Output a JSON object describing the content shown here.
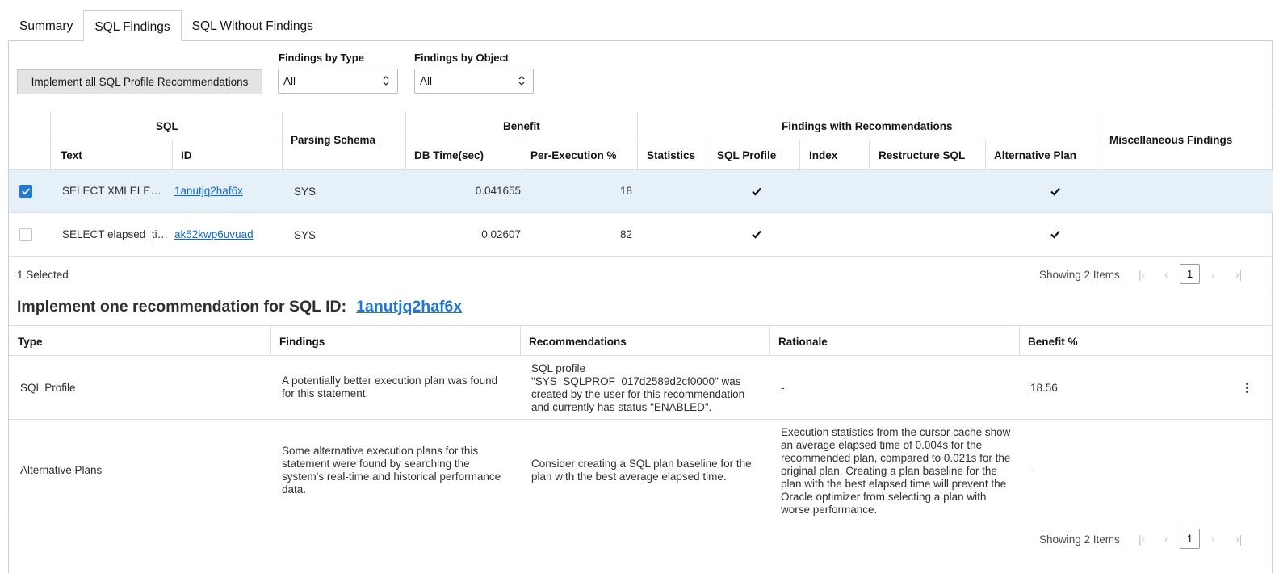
{
  "tabs": [
    {
      "label": "Summary"
    },
    {
      "label": "SQL Findings",
      "active": true
    },
    {
      "label": "SQL Without Findings"
    }
  ],
  "toolbar": {
    "implement_all_label": "Implement all SQL Profile Recommendations",
    "findings_by_type": {
      "label": "Findings by Type",
      "value": "All"
    },
    "findings_by_object": {
      "label": "Findings by Object",
      "value": "All"
    }
  },
  "sql_table": {
    "group_headers": {
      "sql": "SQL",
      "parsing_schema": "Parsing Schema",
      "benefit": "Benefit",
      "findings_with_recommendations": "Findings with Recommendations",
      "misc_findings": "Miscellaneous Findings"
    },
    "sub_headers": {
      "text": "Text",
      "id": "ID",
      "db_time": "DB Time(sec)",
      "per_execution": "Per-Execution %",
      "statistics": "Statistics",
      "sql_profile": "SQL Profile",
      "index": "Index",
      "restructure_sql": "Restructure SQL",
      "alternative_plan": "Alternative Plan"
    },
    "rows": [
      {
        "selected": true,
        "text": "SELECT XMLELE…",
        "id": "1anutjq2haf6x",
        "schema": "SYS",
        "db_time": "0.041655",
        "per_execution": "18",
        "sql_profile": true,
        "alternative_plan": true
      },
      {
        "selected": false,
        "text": "SELECT elapsed_ti…",
        "id": "ak52kwp6uvuad",
        "schema": "SYS",
        "db_time": "0.02607",
        "per_execution": "82",
        "sql_profile": true,
        "alternative_plan": true
      }
    ],
    "selected_count": "1 Selected",
    "showing": "Showing 2 Items",
    "page": "1"
  },
  "recommendation": {
    "title": "Implement one recommendation for SQL ID:",
    "sql_id": "1anutjq2haf6x",
    "headers": {
      "type": "Type",
      "findings": "Findings",
      "recommendations": "Recommendations",
      "rationale": "Rationale",
      "benefit": "Benefit %"
    },
    "rows": [
      {
        "type": "SQL Profile",
        "findings": "A potentially better execution plan was found for this statement.",
        "recommendations": "SQL profile \"SYS_SQLPROF_017d2589d2cf0000\" was created by the user for this recommendation and currently has status \"ENABLED\".",
        "rationale": "-",
        "benefit": "18.56"
      },
      {
        "type": "Alternative Plans",
        "findings": "Some alternative execution plans for this statement were found by searching the system's real-time and historical performance data.",
        "recommendations": "Consider creating a SQL plan baseline for the plan with the best average elapsed time.",
        "rationale": "Execution statistics from the cursor cache show an average elapsed time of 0.004s for the recommended plan, compared to 0.021s for the original plan. Creating a plan baseline for the plan with the best elapsed time will prevent the Oracle optimizer from selecting a plan with worse performance.",
        "benefit": "-"
      }
    ],
    "showing": "Showing 2 Items",
    "page": "1"
  }
}
